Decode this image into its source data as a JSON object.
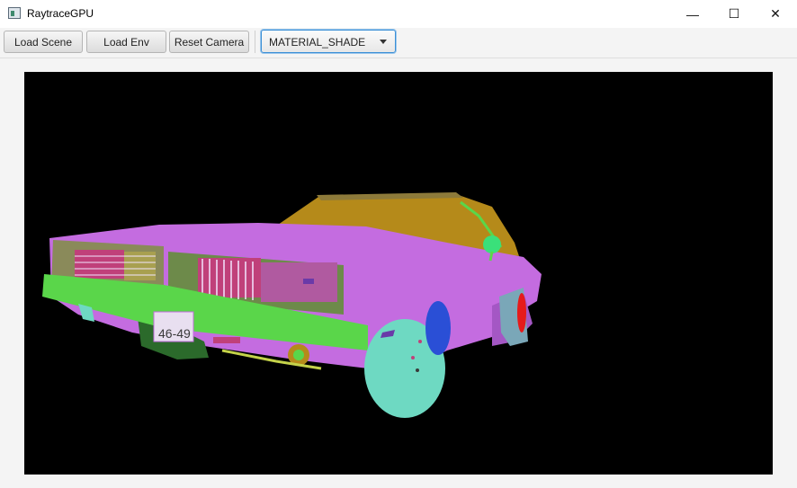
{
  "window": {
    "title": "RaytraceGPU",
    "controls": {
      "minimize": "—",
      "maximize": "☐",
      "close": "✕"
    }
  },
  "toolbar": {
    "load_scene": "Load Scene",
    "load_env": "Load Env",
    "reset_camera": "Reset Camera",
    "render_mode": {
      "selected": "MATERIAL_SHADE"
    }
  },
  "viewport": {
    "scene": "material-shaded car render",
    "license_plate_text": "46-49",
    "colors": {
      "background": "#000000",
      "body": "#c46ce0",
      "trim": "#5ad64a",
      "wheel": "#6ed9c2",
      "glass": "#b58a1a",
      "grille": "#c0407a",
      "brake": "#e51b1b",
      "tire_blue": "#2a4fd6"
    }
  }
}
